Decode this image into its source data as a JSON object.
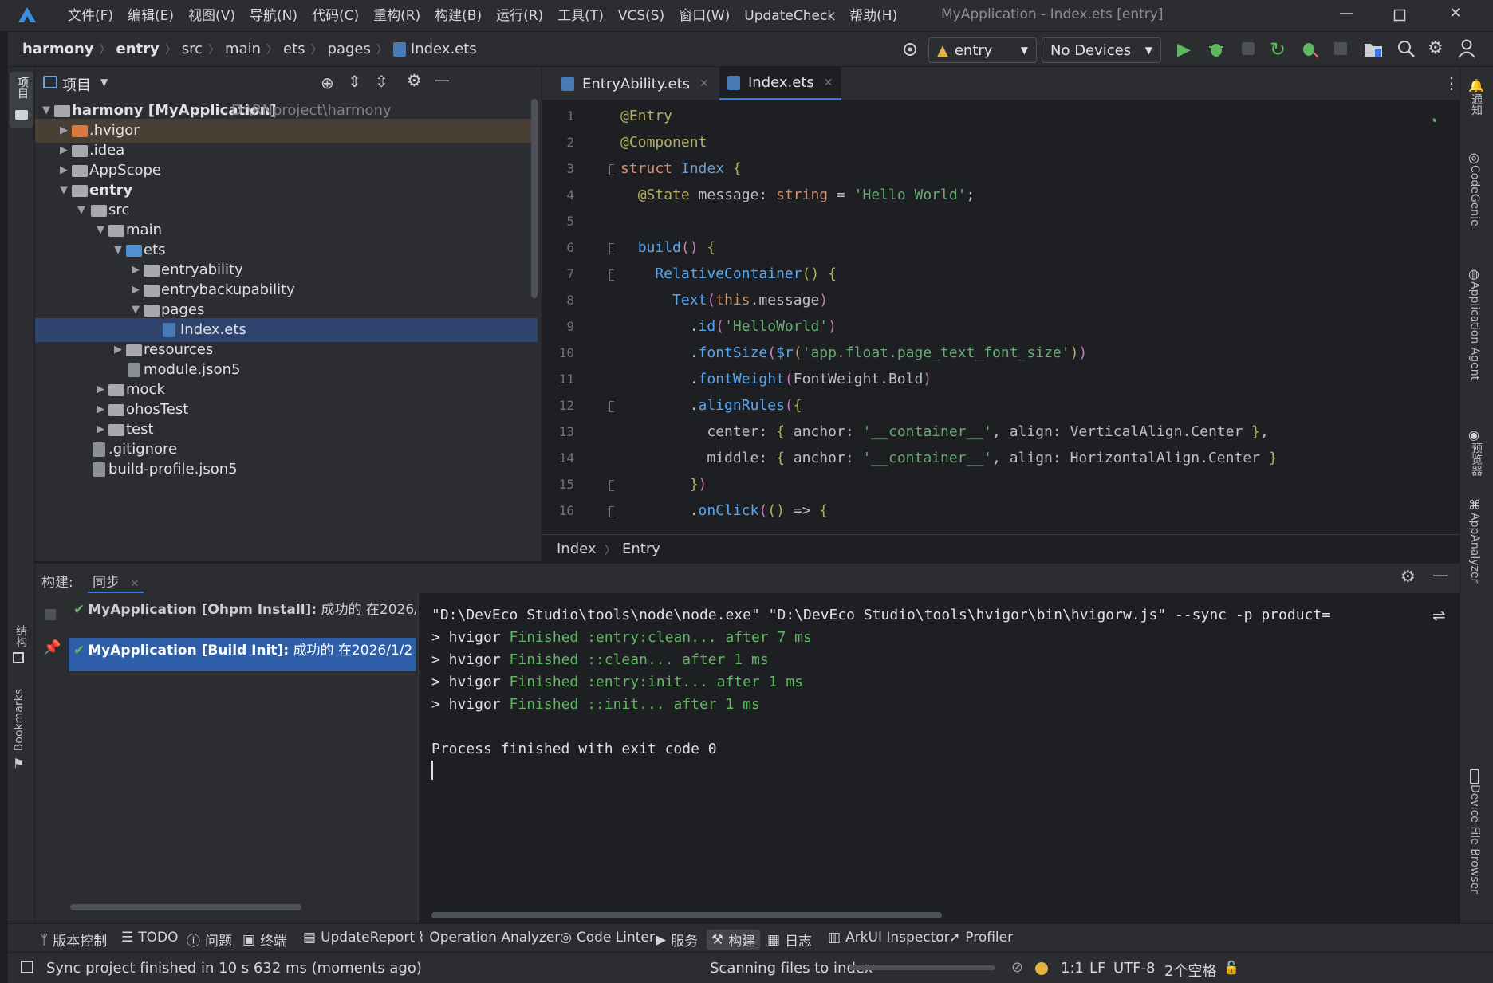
{
  "title_bar": {
    "menu": [
      "文件(F)",
      "编辑(E)",
      "视图(V)",
      "导航(N)",
      "代码(C)",
      "重构(R)",
      "构建(B)",
      "运行(R)",
      "工具(T)",
      "VCS(S)",
      "窗口(W)",
      "UpdateCheck",
      "帮助(H)"
    ],
    "window_title": "MyApplication - Index.ets [entry]"
  },
  "nav_bar": {
    "breadcrumbs": [
      "harmony",
      "entry",
      "src",
      "main",
      "ets",
      "pages",
      "Index.ets"
    ],
    "run_config": "entry",
    "device": "No Devices"
  },
  "left_strip": {
    "project_label": "项目",
    "structure_label": "结构",
    "bookmarks_label": "Bookmarks"
  },
  "right_strip": {
    "notifications_label": "通知",
    "codegenie_label": "CodeGenie",
    "agent_label": "Application Agent",
    "preview_label": "预览器",
    "analyzer_label": "AppAnalyzer",
    "device_browser_label": "Device File Browser"
  },
  "project_panel": {
    "title": "项目",
    "tree": [
      {
        "label": "harmony [MyApplication]",
        "path": "D:\\RNproject\\harmony"
      },
      {
        "label": ".hvigor"
      },
      {
        "label": ".idea"
      },
      {
        "label": "AppScope"
      },
      {
        "label": "entry"
      },
      {
        "label": "src"
      },
      {
        "label": "main"
      },
      {
        "label": "ets"
      },
      {
        "label": "entryability"
      },
      {
        "label": "entrybackupability"
      },
      {
        "label": "pages"
      },
      {
        "label": "Index.ets"
      },
      {
        "label": "resources"
      },
      {
        "label": "module.json5"
      },
      {
        "label": "mock"
      },
      {
        "label": "ohosTest"
      },
      {
        "label": "test"
      },
      {
        "label": ".gitignore"
      },
      {
        "label": "build-profile.json5"
      }
    ]
  },
  "editor": {
    "tabs": [
      "EntryAbility.ets",
      "Index.ets"
    ],
    "active_tab": "Index.ets",
    "line_numbers": [
      "1",
      "2",
      "3",
      "4",
      "5",
      "6",
      "7",
      "8",
      "9",
      "10",
      "11",
      "12",
      "13",
      "14",
      "15",
      "16"
    ],
    "breadcrumb": [
      "Index",
      "Entry"
    ]
  },
  "build_panel": {
    "label": "构建:",
    "tab": "同步",
    "tasks": [
      {
        "name": "MyApplication [Ohpm Install]:",
        "status": "成功的 在2026/"
      },
      {
        "name": "MyApplication [Build Init]:",
        "status": "成功的 在2026/1/2"
      }
    ],
    "output": {
      "command": "\"D:\\DevEco Studio\\tools\\node\\node.exe\" \"D:\\DevEco Studio\\tools\\hvigor\\bin\\hvigorw.js\" --sync -p product=",
      "lines": [
        {
          "prefix": "> hvigor ",
          "text": "Finished :entry:clean... after 7 ms"
        },
        {
          "prefix": "> hvigor ",
          "text": "Finished ::clean... after 1 ms"
        },
        {
          "prefix": "> hvigor ",
          "text": "Finished :entry:init... after 1 ms"
        },
        {
          "prefix": "> hvigor ",
          "text": "Finished ::init... after 1 ms"
        }
      ],
      "exit": "Process finished with exit code 0"
    }
  },
  "tool_windows": [
    "版本控制",
    "TODO",
    "问题",
    "终端",
    "UpdateReport",
    "Operation Analyzer",
    "Code Linter",
    "服务",
    "构建",
    "日志",
    "ArkUI Inspector",
    "Profiler"
  ],
  "status_bar": {
    "message": "Sync project finished in 10 s 632 ms (moments ago)",
    "indexing": "Scanning files to index",
    "position": "1:1",
    "line_sep": "LF",
    "encoding": "UTF-8",
    "indent": "2个空格"
  },
  "colors": {
    "accent": "#3574f0",
    "selection": "#2e436e",
    "build_selected": "#2f5ea8",
    "success": "#5fb85f"
  }
}
